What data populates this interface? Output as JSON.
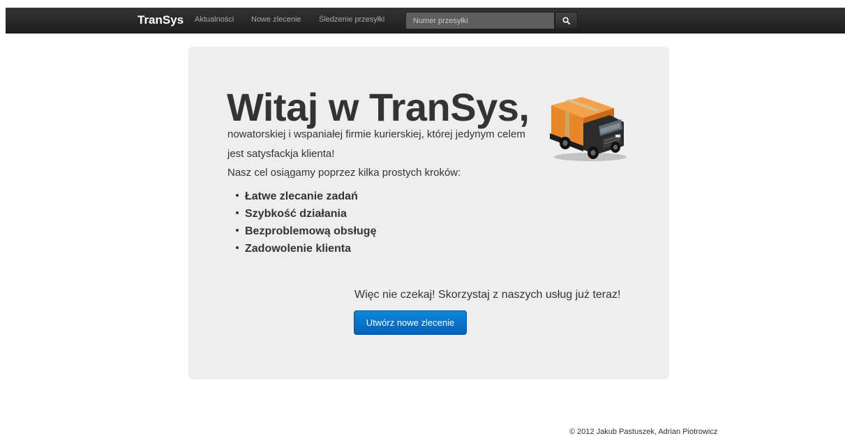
{
  "navbar": {
    "brand": "TranSys",
    "links": [
      {
        "label": "Aktualności"
      },
      {
        "label": "Nowe zlecenie"
      },
      {
        "label": "Śledzenie przesyłki"
      }
    ],
    "search": {
      "placeholder": "Numer przesyłki",
      "button_icon": "search-icon"
    }
  },
  "hero": {
    "title": "Witaj w TranSys,",
    "subtitle": "nowatorskiej i wspaniałej firmie kurierskiej, której jedynym celem jest satysfackja klienta!",
    "lead": "Nasz cel osiągamy poprzez kilka prostych kroków:",
    "steps": [
      "Łatwe zlecanie zadań",
      "Szybkość działania",
      "Bezproblemową obsługę",
      "Zadowolenie klienta"
    ],
    "cta_text": "Więc nie czekaj! Skorzystaj z naszych usług już teraz!",
    "cta_button": "Utwórz nowe zlecenie",
    "illustration_icon": "delivery-truck-icon"
  },
  "footer": {
    "copyright": "© 2012 Jakub Pastuszek, Adrian Piotrowicz"
  },
  "colors": {
    "navbar_bg": "#222222",
    "hero_bg": "#eeeeee",
    "button_primary": "#0a7bd6",
    "truck_cargo": "#e8862a"
  }
}
